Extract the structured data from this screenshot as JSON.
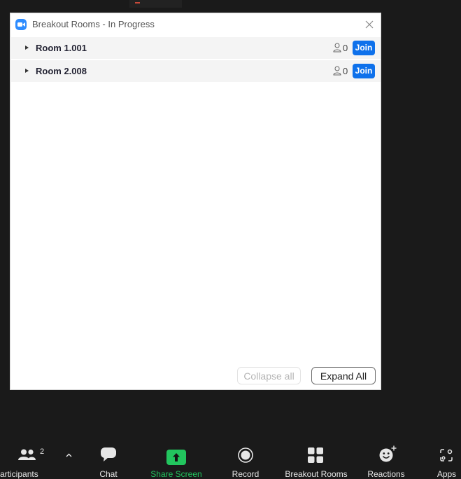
{
  "window": {
    "title": "Breakout Rooms - In Progress"
  },
  "rooms": [
    {
      "name": "Room 1.001",
      "count": "0",
      "join_label": "Join"
    },
    {
      "name": "Room 2.008",
      "count": "0",
      "join_label": "Join"
    }
  ],
  "actions": {
    "collapse_label": "Collapse all",
    "expand_label": "Expand All"
  },
  "toolbar": {
    "participants_label": "Participants",
    "participants_count": "2",
    "chat_label": "Chat",
    "share_label": "Share Screen",
    "record_label": "Record",
    "breakout_label": "Breakout Rooms",
    "reactions_label": "Reactions",
    "apps_label": "Apps"
  },
  "colors": {
    "accent_blue": "#0e71eb",
    "share_green": "#22c55e",
    "toolbar_bg": "#1a1a1a"
  },
  "icons": [
    "zoom-logo-icon",
    "close-icon",
    "caret-right-icon",
    "person-outline-icon",
    "participants-icon",
    "chevron-up-icon",
    "chat-icon",
    "share-screen-icon",
    "record-icon",
    "breakout-rooms-icon",
    "reactions-icon",
    "apps-icon"
  ]
}
